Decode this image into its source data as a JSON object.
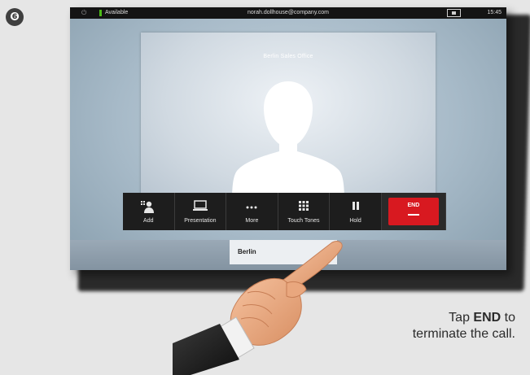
{
  "step": {
    "number": "❻"
  },
  "status_bar": {
    "presence": "Available",
    "address": "norah.dollhouse@company.com",
    "time": "15:45",
    "icons": [
      "power-icon",
      "selfview-icon"
    ]
  },
  "call": {
    "remote_name": "Berlin Sales Office"
  },
  "toolbar": {
    "buttons": [
      {
        "label": "Add",
        "icon": "add-participant-icon"
      },
      {
        "label": "Presentation",
        "icon": "laptop-icon"
      },
      {
        "label": "More",
        "icon": "more-dots-icon"
      },
      {
        "label": "Touch Tones",
        "icon": "keypad-icon"
      },
      {
        "label": "Hold",
        "icon": "pause-icon"
      },
      {
        "label": "END",
        "icon": "end-call-icon",
        "color": "#d81920"
      }
    ]
  },
  "name_tab": {
    "label": "Berlin"
  },
  "instruction": {
    "prefix": "Tap ",
    "emphasis": "END",
    "suffix": " to terminate the call."
  }
}
